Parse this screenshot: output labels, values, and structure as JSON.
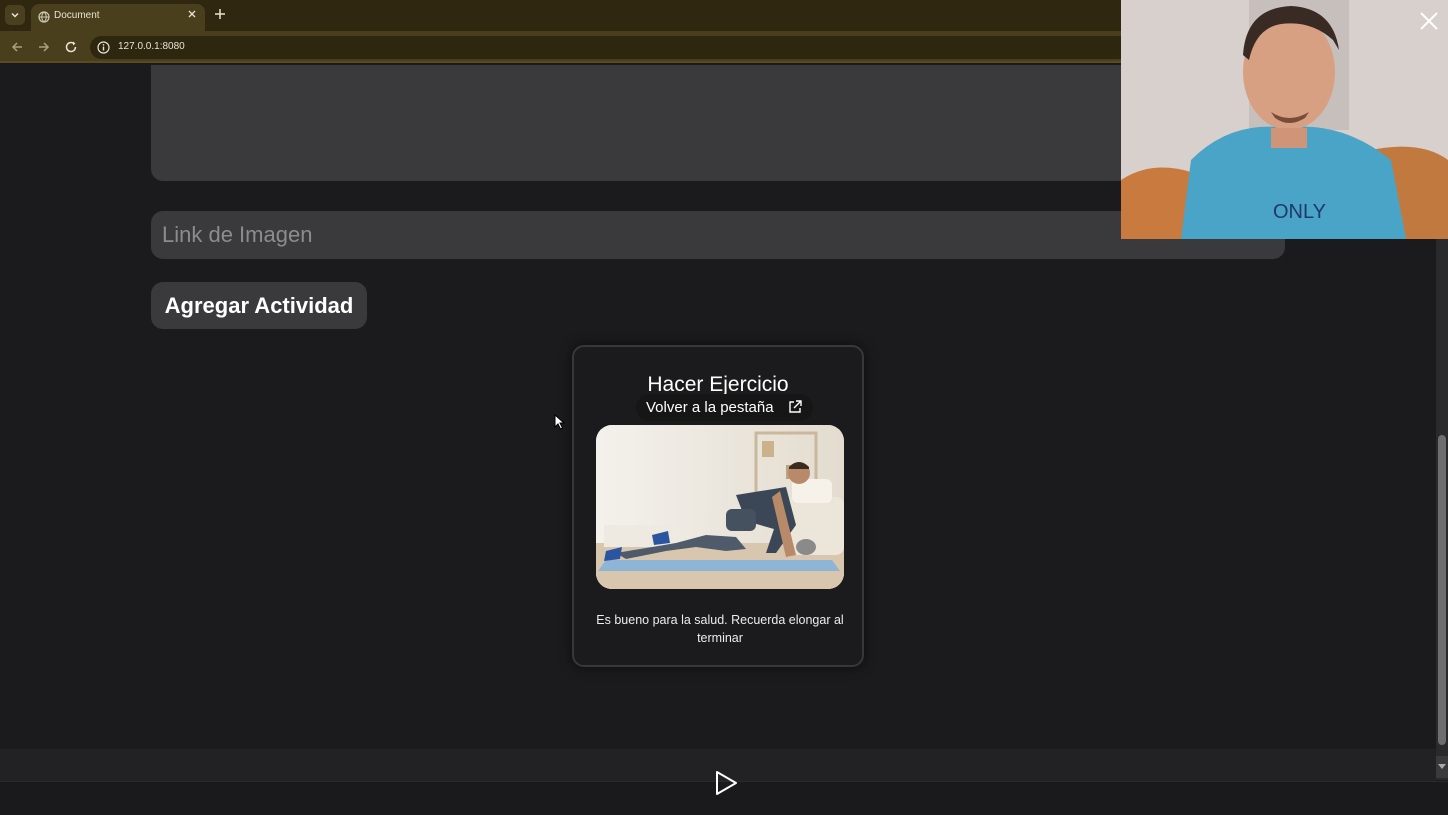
{
  "browser": {
    "tab_title": "Document",
    "url": "127.0.0.1:8080"
  },
  "form": {
    "image_link_placeholder": "Link de Imagen",
    "add_button_label": "Agregar Actividad"
  },
  "card": {
    "title": "Hacer Ejercicio",
    "description": "Es bueno para la salud. Recuerda elongar al terminar",
    "image_alt": "person-exercising-on-mat"
  },
  "overlay": {
    "return_tab_label": "Volver a la pestaña"
  },
  "icons": {
    "tab_search": "chevron-down-icon",
    "favicon": "globe-icon",
    "tab_close": "close-icon",
    "new_tab": "plus-icon",
    "back": "arrow-left-icon",
    "forward": "arrow-right-icon",
    "reload": "reload-icon",
    "site_info": "info-icon",
    "external": "external-link-icon",
    "play": "play-icon",
    "pip_close": "close-icon"
  },
  "colors": {
    "chrome_bg": "#4a3f1c",
    "page_bg": "#1b1b1d",
    "input_bg": "#3a3a3c"
  }
}
